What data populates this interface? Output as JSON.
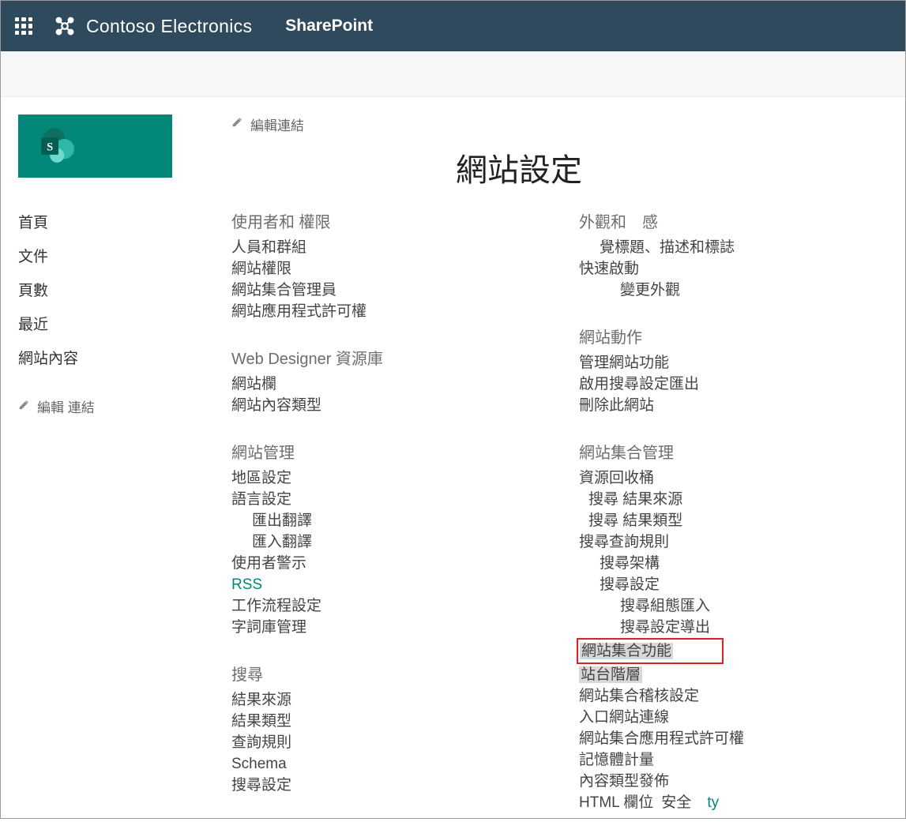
{
  "suite": {
    "org_name": "Contoso Electronics",
    "sp_label": "SharePoint"
  },
  "top_nav_edit": "編輯連結",
  "page_title": "網站設定",
  "quick_launch": {
    "items": [
      "首頁",
      "文件",
      "頁數",
      "最近",
      "網站內容"
    ],
    "edit_label": "編輯 連結"
  },
  "settings_left": [
    {
      "header": "使用者和 權限",
      "links": [
        {
          "label": "人員和群組"
        },
        {
          "label": "網站權限"
        },
        {
          "label": "網站集合管理員"
        },
        {
          "label": "網站應用程式許可權"
        }
      ]
    },
    {
      "header": "Web Designer 資源庫",
      "links": [
        {
          "label": "網站欄"
        },
        {
          "label": "網站內容類型"
        }
      ]
    },
    {
      "header": "網站管理",
      "links": [
        {
          "label": "地區設定"
        },
        {
          "label": "語言設定"
        },
        {
          "label": "匯出翻譯",
          "indent": 1
        },
        {
          "label": "匯入翻譯",
          "indent": 1
        },
        {
          "label": "使用者警示"
        },
        {
          "label": "RSS",
          "teal": true
        },
        {
          "label": "工作流程設定"
        },
        {
          "label": "字詞庫管理"
        }
      ]
    },
    {
      "header": "搜尋",
      "links": [
        {
          "label": "結果來源"
        },
        {
          "label": "結果類型"
        },
        {
          "label": "查詢規則"
        },
        {
          "label": "Schema"
        },
        {
          "label": "搜尋設定"
        }
      ]
    }
  ],
  "settings_right": [
    {
      "header": "外觀和　感",
      "links": [
        {
          "label": "覺標題、描述和標誌",
          "indent": 1
        },
        {
          "label": "快速啟動"
        },
        {
          "label": "變更外觀",
          "indent": 2
        }
      ]
    },
    {
      "header": "網站動作",
      "links": [
        {
          "label": "管理網站功能"
        },
        {
          "label": "啟用搜尋設定匯出"
        },
        {
          "label": "刪除此網站"
        }
      ]
    },
    {
      "header": "網站集合管理",
      "links": [
        {
          "label": "資源回收桶"
        },
        {
          "label": "搜尋 結果來源",
          "indent": 0,
          "pad": true
        },
        {
          "label": "搜尋 結果類型",
          "indent": 0,
          "pad": true
        },
        {
          "label": "搜尋查詢規則"
        },
        {
          "label": "搜尋架構",
          "indent": 1
        },
        {
          "label": "搜尋設定",
          "indent": 1
        },
        {
          "label": "搜尋組態匯入",
          "indent": 2
        },
        {
          "label": "搜尋設定導出",
          "indent": 2
        },
        {
          "label": "網站集合功能",
          "redbox": true
        },
        {
          "label": "站台階層",
          "highlight": true
        },
        {
          "label": "網站集合稽核設定"
        },
        {
          "label": "入口網站連線"
        },
        {
          "label": "網站集合應用程式許可權"
        },
        {
          "label": "記憶體計量"
        },
        {
          "label": "內容類型發佈"
        },
        {
          "label_parts": [
            "HTML 欄位",
            "安全",
            "ty"
          ],
          "html_row": true
        }
      ]
    }
  ]
}
